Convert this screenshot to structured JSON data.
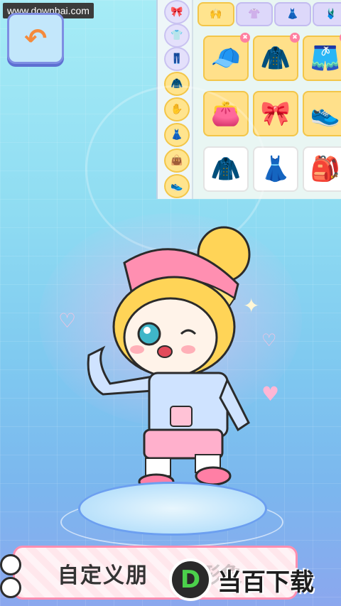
{
  "watermark": "www.downbai.com",
  "back_button": {
    "icon": "back-arrow-icon",
    "glyph": "↶"
  },
  "side_categories": [
    {
      "icon": "hat-icon",
      "glyph": "🎀",
      "active": false
    },
    {
      "icon": "top-icon",
      "glyph": "👕",
      "active": false
    },
    {
      "icon": "pants-icon",
      "glyph": "👖",
      "active": false
    },
    {
      "icon": "coat-icon",
      "glyph": "🧥",
      "active": true
    },
    {
      "icon": "hand-icon",
      "glyph": "✋",
      "active": true
    },
    {
      "icon": "dress-icon",
      "glyph": "👗",
      "active": true
    },
    {
      "icon": "bag-icon",
      "glyph": "👜",
      "active": true
    },
    {
      "icon": "shoes-icon",
      "glyph": "👟",
      "active": true
    }
  ],
  "top_tabs": [
    {
      "icon": "hands-tab-icon",
      "glyph": "🙌",
      "active": true
    },
    {
      "icon": "shirt-tab-icon",
      "glyph": "👚",
      "active": false
    },
    {
      "icon": "dress-tab-icon",
      "glyph": "👗",
      "active": false
    },
    {
      "icon": "skirt-tab-icon",
      "glyph": "🩱",
      "active": false
    }
  ],
  "items": [
    {
      "icon": "pink-cap-icon",
      "glyph": "🧢",
      "style": "yellow",
      "badge": true
    },
    {
      "icon": "blue-jacket-icon",
      "glyph": "🧥",
      "style": "yellow",
      "badge": true
    },
    {
      "icon": "pink-shorts-icon",
      "glyph": "🩳",
      "style": "yellow",
      "badge": true
    },
    {
      "icon": "purse-icon",
      "glyph": "👛",
      "style": "yellow",
      "badge": false
    },
    {
      "icon": "bow-icon",
      "glyph": "🎀",
      "style": "yellow",
      "badge": false
    },
    {
      "icon": "pink-shoes-icon",
      "glyph": "👟",
      "style": "yellow",
      "badge": false
    },
    {
      "icon": "green-jacket-icon",
      "glyph": "🧥",
      "style": "white",
      "badge": false
    },
    {
      "icon": "pink-dress-icon",
      "glyph": "👗",
      "style": "white",
      "badge": false
    },
    {
      "icon": "backpack-icon",
      "glyph": "🎒",
      "style": "white",
      "badge": false
    }
  ],
  "caption": {
    "text": "自定义朋",
    "faded": "友形象"
  },
  "logo": {
    "mark": "D",
    "text": "当百下载"
  },
  "colors": {
    "accent": "#ffe48e",
    "back_border": "#7e8ee3",
    "pedestal": "#6c9ff0",
    "caption_border": "#ff8fb1"
  }
}
